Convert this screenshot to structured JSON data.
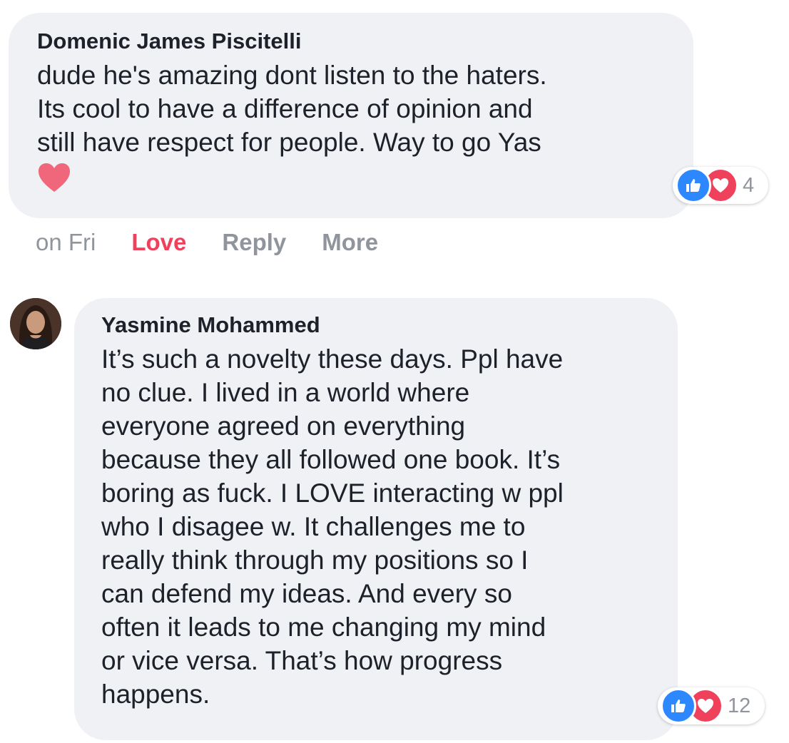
{
  "comments": [
    {
      "author": "Domenic James Piscitelli",
      "text": "dude he's amazing dont listen to the haters.\nIts cool to have a difference of opinion and\nstill have respect for people. Way to go Yas",
      "emoji": "heart-emoji",
      "reaction_count": "4",
      "actions": {
        "time": "on Fri",
        "love": "Love",
        "reply": "Reply",
        "more": "More"
      }
    },
    {
      "author": "Yasmine Mohammed",
      "text": "It’s such a novelty these days. Ppl have\nno clue. I lived in a world where\neveryone agreed on everything\nbecause they all followed one book. It’s\nboring as fuck. I LOVE interacting w ppl\nwho I disagee w. It challenges me to\nreally think through my positions so I\ncan defend my ideas. And every so\noften it leads to me changing my mind\nor vice versa. That’s how progress\nhappens.",
      "reaction_count": "12"
    }
  ],
  "colors": {
    "bubble": "#f0f1f4",
    "like": "#2d88ff",
    "love": "#f0415c",
    "muted": "#90949c",
    "text": "#1d2129"
  },
  "icons": [
    "like-icon",
    "love-icon",
    "heart-emoji",
    "avatar"
  ]
}
